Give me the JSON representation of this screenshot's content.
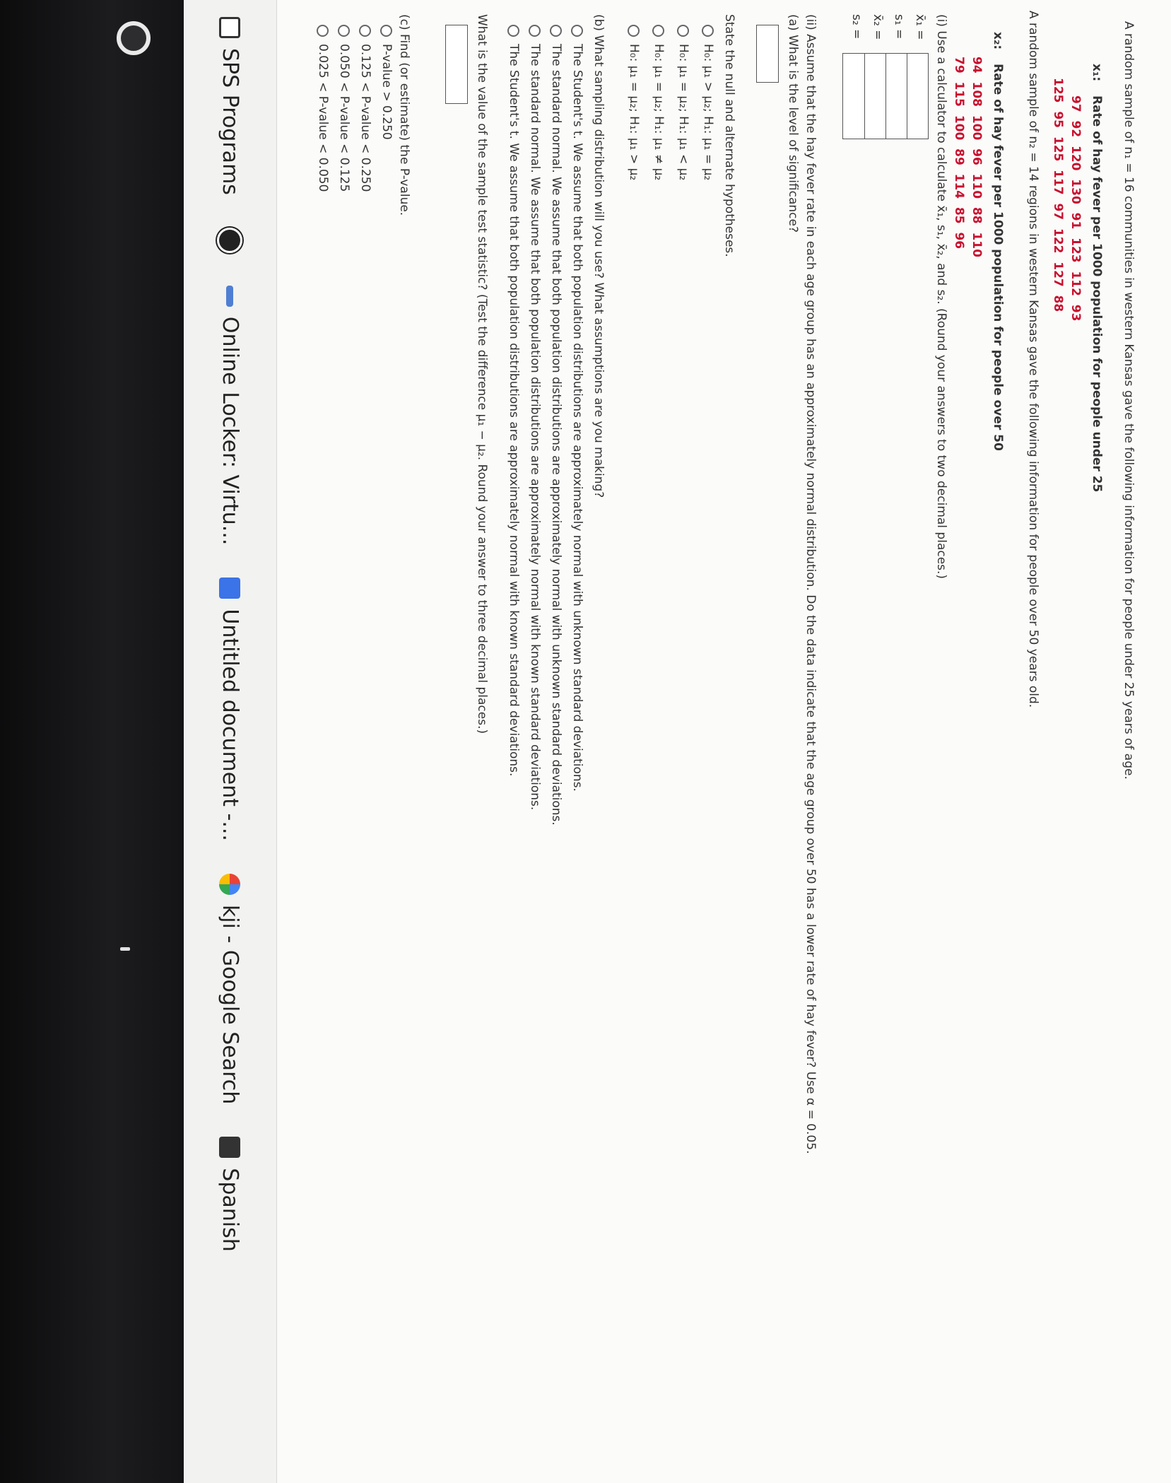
{
  "bookmarks": [
    {
      "label": "SPS Programs",
      "icon": "document-icon"
    },
    {
      "label": "",
      "icon": "globe-icon"
    },
    {
      "label": "Online Locker: Virtu...",
      "icon": "locker-icon"
    },
    {
      "label": "Untitled document -...",
      "icon": "docs-icon"
    },
    {
      "label": "kji - Google Search",
      "icon": "google-icon"
    },
    {
      "label": "Spanish",
      "icon": "folder-icon"
    }
  ],
  "problem": {
    "intro1": "A random sample of n₁ = 16 communities in western Kansas gave the following information for people under 25 years of age.",
    "x1_label": "x₁:",
    "x1_title": "Rate of hay fever per 1000 population for people under 25",
    "x1_row1": "97  92  120  130  91  123  112  93",
    "x1_row2": "125  95  125  117  97  122  127  88",
    "intro2": "A random sample of n₂ = 14 regions in western Kansas gave the following information for people over 50 years old.",
    "x2_label": "x₂:",
    "x2_title": "Rate of hay fever per 1000 population for people over 50",
    "x2_row1": "94  108  100  96  110  88  110",
    "x2_row2": "79  115  100  89  114  85  96",
    "part_i": "(i) Use a calculator to calculate x̄₁, s₁, x̄₂, and s₂. (Round your answers to two decimal places.)",
    "x1bar_label": "x̄₁ =",
    "s1_label": "s₁ =",
    "x2bar_label": "x̄₂ =",
    "s2_label": "s₂ =",
    "part_ii": "(ii) Assume that the hay fever rate in each age group has an approximately normal distribution. Do the data indicate that the age group over 50 has a lower rate of hay fever? Use α = 0.05.",
    "part_a": "(a) What is the level of significance?",
    "hyp_prompt": "State the null and alternate hypotheses.",
    "hyp_options": [
      "H₀: μ₁ > μ₂; H₁: μ₁ = μ₂",
      "H₀: μ₁ = μ₂; H₁: μ₁ < μ₂",
      "H₀: μ₁ = μ₂; H₁: μ₁ ≠ μ₂",
      "H₀: μ₁ = μ₂; H₁: μ₁ > μ₂"
    ],
    "part_b": "(b) What sampling distribution will you use? What assumptions are you making?",
    "dist_options": [
      "The Student's t. We assume that both population distributions are approximately normal with unknown standard deviations.",
      "The standard normal. We assume that both population distributions are approximately normal with unknown standard deviations.",
      "The standard normal. We assume that both population distributions are approximately normal with known standard deviations.",
      "The Student's t. We assume that both population distributions are approximately normal with known standard deviations."
    ],
    "test_stat_q": "What is the value of the sample test statistic? (Test the difference μ₁ − μ₂. Round your answer to three decimal places.)",
    "part_c": "(c) Find (or estimate) the P-value.",
    "pvalue_options": [
      "P-value > 0.250",
      "0.125 < P-value < 0.250",
      "0.050 < P-value < 0.125",
      "0.025 < P-value < 0.050"
    ]
  }
}
